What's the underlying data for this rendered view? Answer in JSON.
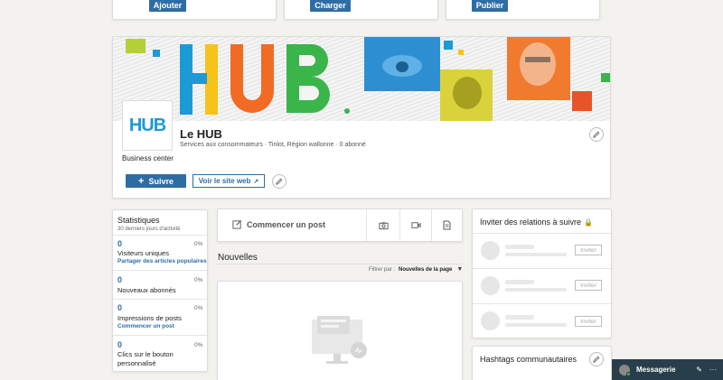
{
  "top_cards": [
    {
      "button": "Ajouter"
    },
    {
      "button": "Charger"
    },
    {
      "button": "Publier"
    }
  ],
  "company": {
    "name": "Le HUB",
    "logo_text": "HUB",
    "banner_text": "HUB",
    "details": "Services aux consommateurs · Tinlot, Région wallonne · 0 abonné",
    "tagline": "Business center",
    "follow_label": "Suivre",
    "website_label": "Voir le site web"
  },
  "stats": {
    "title": "Statistiques",
    "subtitle": "30 derniers jours d'activité",
    "items": [
      {
        "value": "0",
        "pct": "0%",
        "label": "Visiteurs uniques",
        "link": "Partager des articles populaires"
      },
      {
        "value": "0",
        "pct": "0%",
        "label": "Nouveaux abonnés",
        "link": ""
      },
      {
        "value": "0",
        "pct": "0%",
        "label": "Impressions de posts",
        "link": "Commencer un post"
      },
      {
        "value": "0",
        "pct": "0%",
        "label": "Clics sur le bouton personnalisé",
        "link": ""
      }
    ]
  },
  "composer": {
    "start_post": "Commencer un post"
  },
  "feed": {
    "title": "Nouvelles",
    "filter_label": "Filtrer par :",
    "filter_value": "Nouvelles de la page"
  },
  "invite": {
    "title": "Inviter des relations à suivre",
    "button": "Inviter"
  },
  "hashtags": {
    "title": "Hashtags communautaires"
  },
  "messaging": {
    "label": "Messagerie"
  },
  "colors": {
    "accent": "#2e6da4",
    "messaging_bg": "#283e4a",
    "hub_blue": "#1c9ad6",
    "hub_orange": "#f26b24",
    "hub_green": "#39b54a",
    "hub_yellow": "#f7c31a"
  }
}
